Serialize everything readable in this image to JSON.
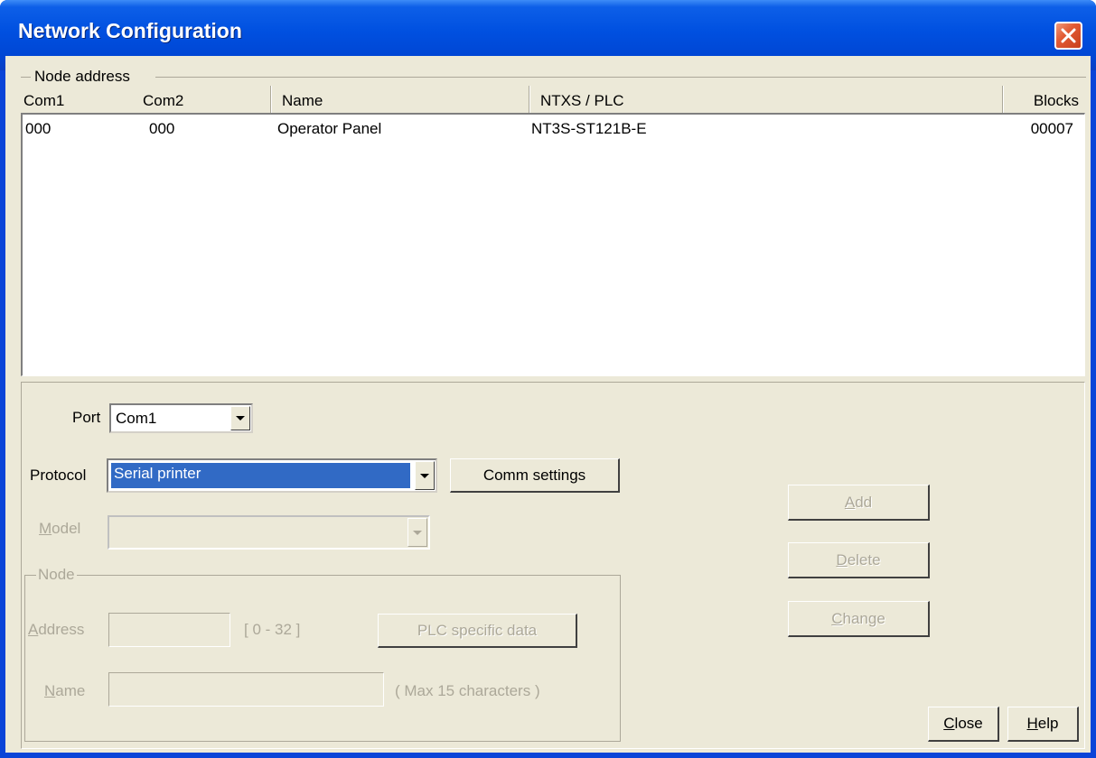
{
  "window": {
    "title": "Network Configuration"
  },
  "list": {
    "group_label": "Node address",
    "columns": {
      "com1": "Com1",
      "com2": "Com2",
      "name": "Name",
      "ntxs": "NTXS / PLC",
      "blocks": "Blocks"
    },
    "rows": [
      {
        "com1": "000",
        "com2": "000",
        "name": "Operator Panel",
        "ntxs": "NT3S-ST121B-E",
        "blocks": "00007"
      }
    ]
  },
  "form": {
    "port_label": "Port",
    "port_value": "Com1",
    "protocol_label": "Protocol",
    "protocol_value": "Serial printer",
    "comm_settings_label": "Comm settings",
    "model_label_pre": "",
    "model_label_u": "M",
    "model_label_post": "odel",
    "model_value": "",
    "node_group_label": "Node",
    "address_label_u": "A",
    "address_label_post": "ddress",
    "address_value": "",
    "address_range": "[ 0 - 32 ]",
    "plc_specific_label": "PLC specific data",
    "name_label_u": "N",
    "name_label_post": "ame",
    "name_value": "",
    "name_hint": "( Max 15 characters )"
  },
  "actions": {
    "add_u": "A",
    "add_post": "dd",
    "delete_u": "D",
    "delete_post": "elete",
    "change_u": "C",
    "change_post": "hange",
    "close_u": "C",
    "close_post": "lose",
    "help_u": "H",
    "help_post": "elp"
  },
  "icons": {
    "close": "close-x-icon",
    "dropdown": "chevron-down-icon"
  },
  "colors": {
    "title_bar": "#0050e0",
    "selection": "#316ac5",
    "dialog_bg": "#ece9d8",
    "close_button": "#e25b35"
  }
}
